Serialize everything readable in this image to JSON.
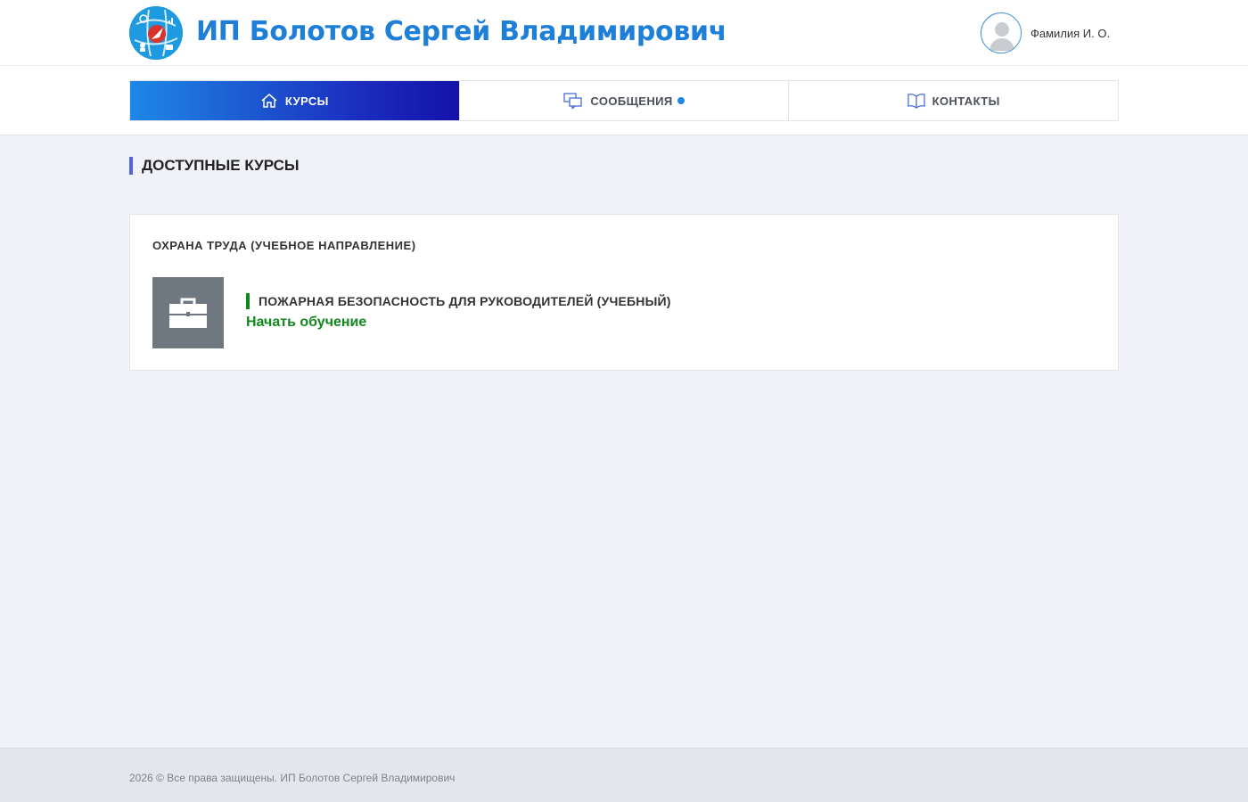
{
  "header": {
    "site_title": "ИП Болотов Сергей Владимирович",
    "user_name": "Фамилия И. О."
  },
  "nav": {
    "tabs": [
      {
        "label": "КУРСЫ",
        "icon": "home-icon",
        "active": true
      },
      {
        "label": "СООБЩЕНИЯ",
        "icon": "chat-icon",
        "active": false,
        "has_indicator": true
      },
      {
        "label": "КОНТАКТЫ",
        "icon": "book-icon",
        "active": false
      }
    ]
  },
  "main": {
    "section_title": "ДОСТУПНЫЕ КУРСЫ",
    "direction": {
      "title": "ОХРАНА ТРУДА (УЧЕБНОЕ НАПРАВЛЕНИЕ)",
      "courses": [
        {
          "title": "ПОЖАРНАЯ БЕЗОПАСНОСТЬ ДЛЯ РУКОВОДИТЕЛЕЙ (УЧЕБНЫЙ)",
          "action_label": "Начать обучение",
          "icon": "briefcase-icon"
        }
      ]
    }
  },
  "footer": {
    "copyright": "2026 © Все права защищены. ИП Болотов Сергей Владимирович"
  },
  "colors": {
    "brand_blue": "#1e7fd8",
    "active_tab_start": "#1e88e5",
    "active_tab_end": "#1412a8",
    "accent_green": "#11891d",
    "section_marker": "#4e63e0",
    "page_bg": "#f0f2f7"
  }
}
